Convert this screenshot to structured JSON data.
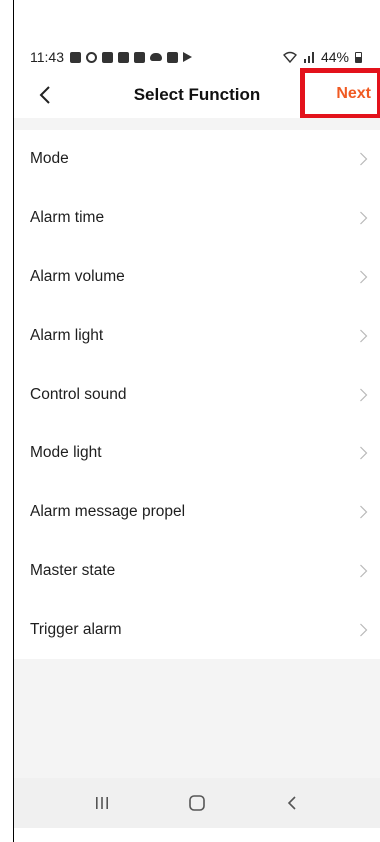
{
  "status_bar": {
    "time": "11:43",
    "battery": "44%",
    "icons": [
      "notification-app-icon",
      "circle-app-icon",
      "square-app-icon",
      "mail-icon",
      "image-icon",
      "cloud-icon",
      "youtube-icon",
      "play-icon"
    ],
    "right_icons": [
      "wifi-icon",
      "signal-icon",
      "battery-icon"
    ]
  },
  "header": {
    "title": "Select Function",
    "next_label": "Next",
    "back_icon": "chevron-left-icon"
  },
  "colors": {
    "accent": "#f05a22",
    "highlight_box": "#e3121b",
    "background_gray": "#f4f4f4"
  },
  "functions": [
    {
      "label": "Mode"
    },
    {
      "label": "Alarm time"
    },
    {
      "label": "Alarm volume"
    },
    {
      "label": "Alarm light"
    },
    {
      "label": "Control sound"
    },
    {
      "label": "Mode light"
    },
    {
      "label": "Alarm message propel"
    },
    {
      "label": "Master state"
    },
    {
      "label": "Trigger alarm"
    }
  ],
  "nav_bar": {
    "buttons": [
      "recent-apps-icon",
      "home-icon",
      "back-icon"
    ]
  }
}
